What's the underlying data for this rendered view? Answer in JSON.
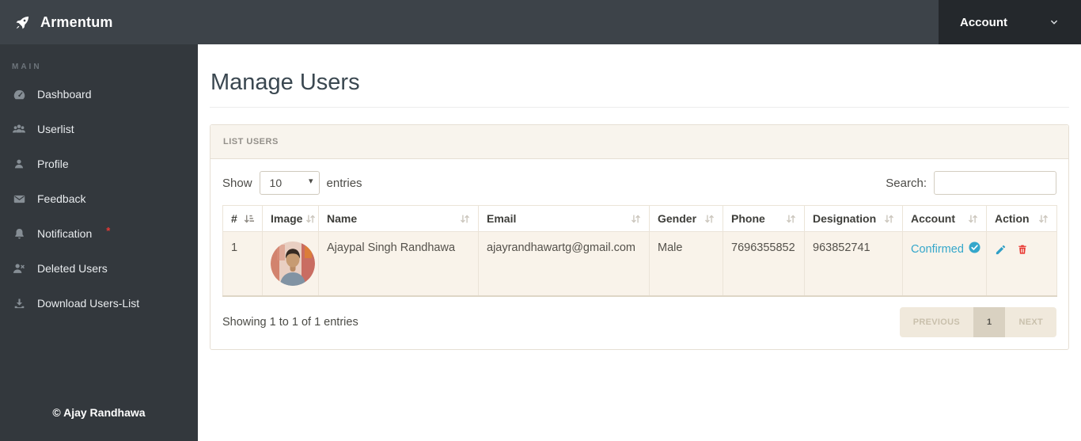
{
  "navbar": {
    "brand": "Armentum",
    "account": {
      "label": "Account"
    }
  },
  "sidebar": {
    "section_label": "MAIN",
    "items": [
      {
        "label": "Dashboard"
      },
      {
        "label": "Userlist"
      },
      {
        "label": "Profile"
      },
      {
        "label": "Feedback"
      },
      {
        "label": "Notification",
        "badge": "*"
      },
      {
        "label": "Deleted Users"
      },
      {
        "label": "Download Users-List"
      }
    ],
    "copyright": "© Ajay Randhawa"
  },
  "page": {
    "title": "Manage Users",
    "panel": {
      "title": "LIST USERS",
      "controls": {
        "show_label": "Show",
        "page_length": "10",
        "entries_label": "entries",
        "search_label": "Search:",
        "search_value": ""
      },
      "table": {
        "headers": [
          "#",
          "Image",
          "Name",
          "Email",
          "Gender",
          "Phone",
          "Designation",
          "Account",
          "Action"
        ],
        "rows": [
          {
            "index": "1",
            "name": "Ajaypal Singh Randhawa",
            "email": "ajayrandhawartg@gmail.com",
            "gender": "Male",
            "phone": "7696355852",
            "designation": "963852741",
            "account_status": "Confirmed"
          }
        ]
      },
      "footer": {
        "info": "Showing 1 to 1 of 1 entries",
        "pagination": {
          "previous": "PREVIOUS",
          "page": "1",
          "next": "NEXT"
        }
      }
    }
  },
  "colors": {
    "navbar_bg": "#3d4349",
    "account_bg": "#24282c",
    "sidebar_bg": "#33383d",
    "panel_header_bg": "#f8f4ed",
    "panel_border": "#e6dfd4",
    "row_bg": "#f9f3ea",
    "accent_blue": "#35a7cb",
    "danger_red": "#e8322c",
    "notification_badge_red": "#e53935",
    "pagination_bg": "#f0e9dc",
    "pagination_active_bg": "#d9d1c1"
  }
}
